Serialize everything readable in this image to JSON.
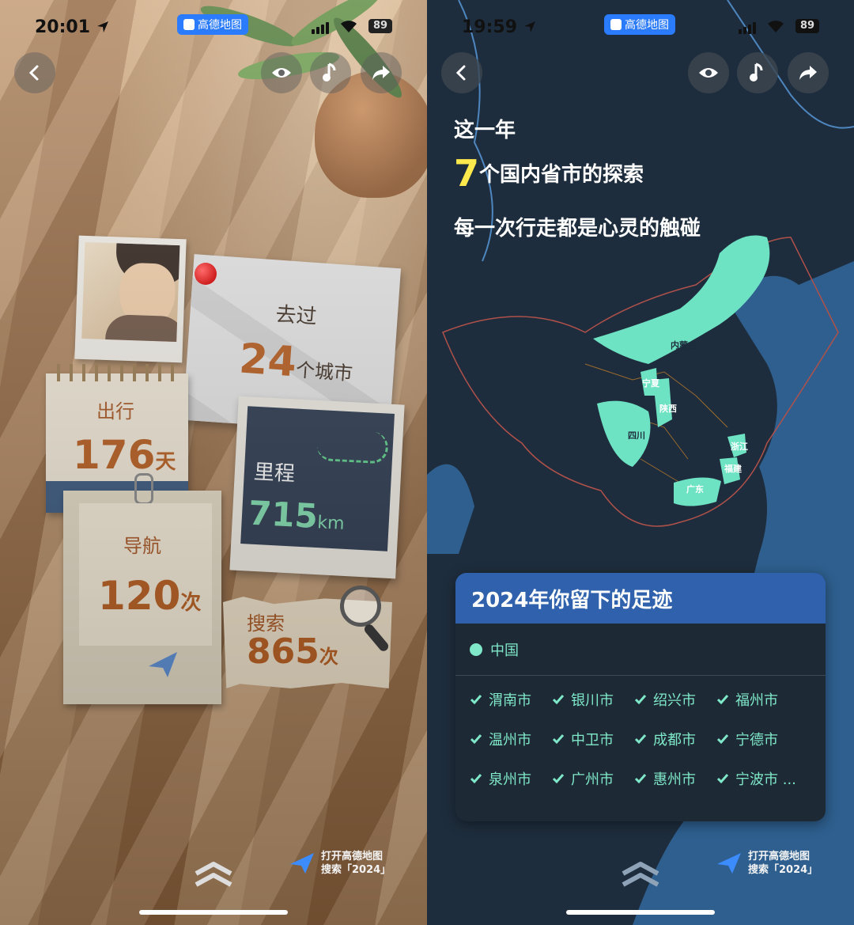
{
  "left": {
    "status": {
      "time": "20:01",
      "app_pill": "高德地图",
      "battery": "89"
    },
    "cards": {
      "visited_label": "去过",
      "visited_value": "24",
      "visited_unit": "个城市",
      "trip_label": "出行",
      "trip_value": "176",
      "trip_unit": "天",
      "nav_label": "导航",
      "nav_value": "120",
      "nav_unit": "次",
      "mileage_label": "里程",
      "mileage_value": "715",
      "mileage_unit": "km",
      "search_label": "搜索",
      "search_value": "865",
      "search_unit": "次"
    },
    "footer": {
      "line1": "打开高德地图",
      "line2": "搜索「2024」"
    }
  },
  "right": {
    "status": {
      "time": "19:59",
      "app_pill": "高德地图",
      "battery": "89"
    },
    "headline": {
      "line1": "这一年",
      "count": "7",
      "line2_rest": "个国内省市的探索",
      "line3": "每一次行走都是心灵的触碰"
    },
    "map_labels": [
      "内蒙古",
      "宁夏",
      "陕西",
      "四川",
      "浙江",
      "福建",
      "广东"
    ],
    "footprint": {
      "title": "2024年你留下的足迹",
      "country": "中国",
      "cities": [
        "渭南市",
        "银川市",
        "绍兴市",
        "福州市",
        "温州市",
        "中卫市",
        "成都市",
        "宁德市",
        "泉州市",
        "广州市",
        "惠州市",
        "宁波市 ..."
      ]
    },
    "footer": {
      "line1": "打开高德地图",
      "line2": "搜索「2024」"
    }
  },
  "colors": {
    "accent_orange": "#b85a19",
    "highlight_green": "#7fe8c8",
    "count_yellow": "#ffe94d",
    "footprint_header": "#2f61ad"
  },
  "icons": [
    "back-icon",
    "eye-icon",
    "music-icon",
    "share-icon",
    "location-arrow-icon",
    "wifi-icon",
    "globe-icon",
    "check-icon",
    "paper-plane-icon",
    "swipe-up-icon"
  ]
}
